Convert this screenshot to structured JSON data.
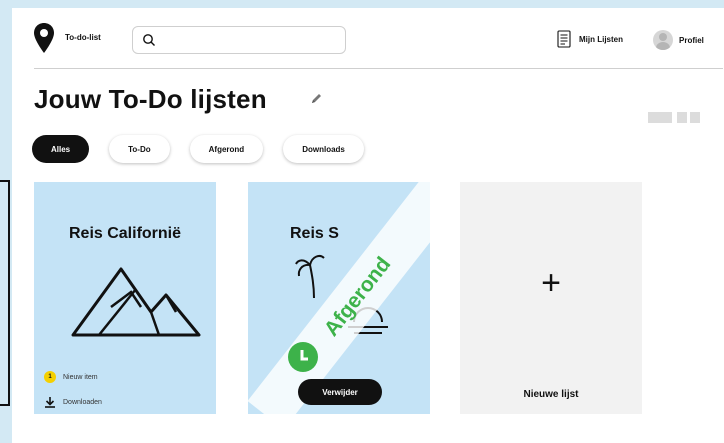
{
  "header": {
    "logo_text": "To-do-list",
    "search_placeholder": "",
    "my_lists_label": "Mijn Lijsten",
    "profile_label": "Profiel"
  },
  "page_title": "Jouw To-Do lijsten",
  "filters": [
    "Alles",
    "To-Do",
    "Afgerond",
    "Downloads"
  ],
  "active_filter": "Alles",
  "cards": [
    {
      "title": "Reis Californië",
      "badge_count": "1",
      "new_item_label": "Nieuw item",
      "download_label": "Downloaden",
      "icon": "mountain-icon"
    },
    {
      "title": "Reis Spanje",
      "title_visible": "Reis S",
      "status_banner": "Afgerond",
      "delete_label": "Verwijder",
      "icons": [
        "palm-tree-icon",
        "sunset-icon",
        "clock-icon"
      ]
    },
    {
      "plus": "+",
      "label": "Nieuwe lijst"
    }
  ],
  "colors": {
    "background": "#d3e9f4",
    "card_blue": "#c4e3f6",
    "card_gray": "#f2f2f2",
    "accent_green": "#3db24a",
    "badge_yellow": "#f5d000",
    "active_pill": "#111111"
  }
}
